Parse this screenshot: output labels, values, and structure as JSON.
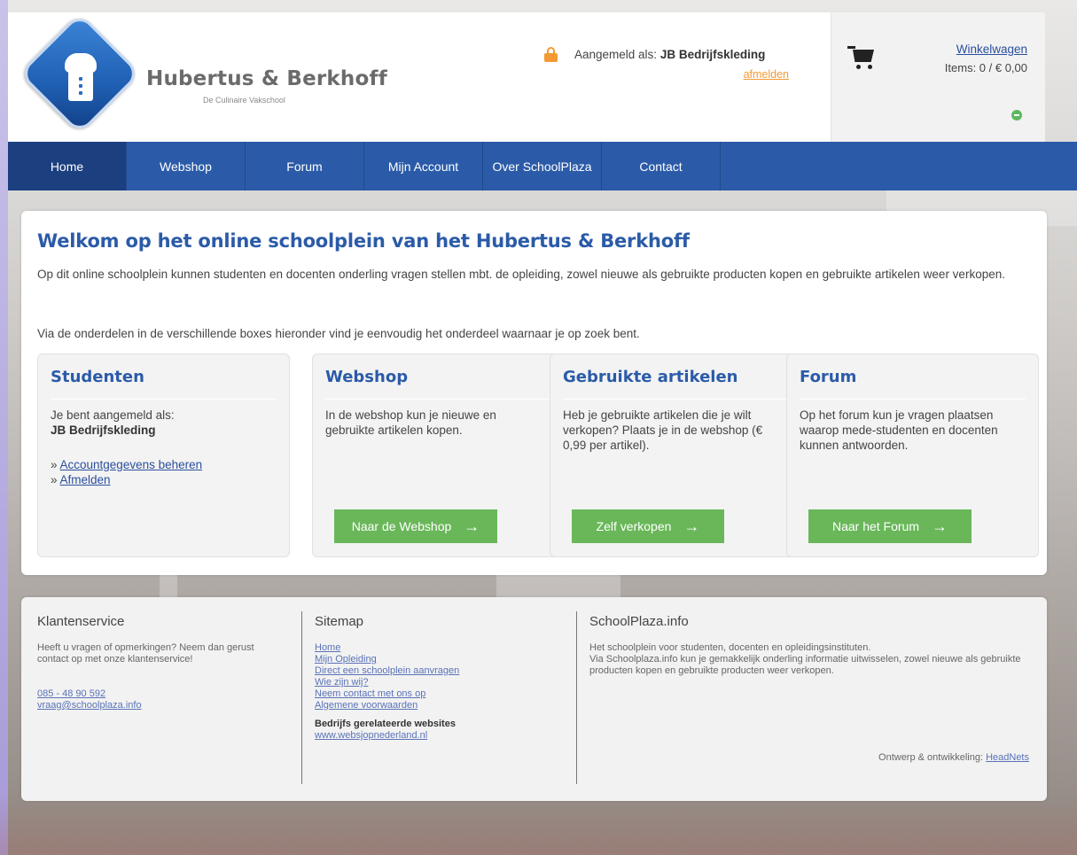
{
  "header": {
    "brand_name": "Hubertus & Berkhoff",
    "brand_sub": "De Culinaire Vakschool",
    "login_prefix": "Aangemeld als: ",
    "login_user": "JB Bedrijfskleding",
    "logout_label": "afmelden",
    "cart_title": "Winkelwagen",
    "cart_items": "Items: 0 / € 0,00"
  },
  "nav": {
    "items": [
      "Home",
      "Webshop",
      "Forum",
      "Mijn Account",
      "Over SchoolPlaza",
      "Contact"
    ],
    "active": "Home"
  },
  "main": {
    "title": "Welkom op het online schoolplein van het Hubertus & Berkhoff",
    "intro": "Op dit online schoolplein kunnen studenten en docenten onderling vragen stellen mbt. de opleiding, zowel nieuwe als gebruikte producten kopen en gebruikte artikelen weer verkopen.",
    "intro2": "Via de onderdelen in de verschillende boxes hieronder vind je eenvoudig het onderdeel waarnaar je op zoek bent.",
    "boxes": {
      "students": {
        "title": "Studenten",
        "text_line1": "Je bent aangemeld als:",
        "text_user": "JB Bedrijfskleding",
        "link_prefix": "» ",
        "link_account": "Accountgegevens beheren",
        "link_logout": "Afmelden"
      },
      "webshop": {
        "title": "Webshop",
        "text": "In de webshop kun je nieuwe en gebruikte artikelen kopen.",
        "button": "Naar de Webshop"
      },
      "used": {
        "title": "Gebruikte artikelen",
        "text": "Heb je gebruikte artikelen die je wilt verkopen? Plaats je in de webshop (€ 0,99 per artikel).",
        "button": "Zelf verkopen"
      },
      "forum": {
        "title": "Forum",
        "text": "Op het forum kun je vragen plaatsen waarop mede-studenten en docenten kunnen antwoorden.",
        "button": "Naar het Forum"
      }
    }
  },
  "footer": {
    "service": {
      "title": "Klantenservice",
      "text": "Heeft u vragen of opmerkingen? Neem dan gerust contact op met onze klantenservice!",
      "phone": "085 - 48 90 592",
      "email": "vraag@schoolplaza.info"
    },
    "sitemap": {
      "title": "Sitemap",
      "links": [
        "Home",
        "Mijn Opleiding",
        "Direct een schoolplein aanvragen",
        "Wie zijn wij?",
        "Neem contact met ons op",
        "Algemene voorwaarden"
      ],
      "related_title": "Bedrijfs gerelateerde websites",
      "related_link": "www.websjopnederland.nl"
    },
    "about": {
      "title": "SchoolPlaza.info",
      "text1": "Het schoolplein voor studenten, docenten en opleidingsinstituten.",
      "text2": "Via Schoolplaza.info kun je gemakkelijk onderling informatie uitwisselen, zowel nieuwe als gebruikte producten kopen en gebruikte producten weer verkopen.",
      "credit_prefix": "Ontwerp & ontwikkeling: ",
      "credit_link": "HeadNets"
    }
  },
  "colors": {
    "primary": "#2b5ba8",
    "nav_active": "#1c3f80",
    "accent_orange": "#f39a33",
    "button_green": "#6ab75a"
  },
  "icons": {
    "lock": "lock-icon",
    "cart": "cart-icon",
    "cart_status": "minus-circle-icon",
    "button_arrow": "arrow-right-icon"
  }
}
